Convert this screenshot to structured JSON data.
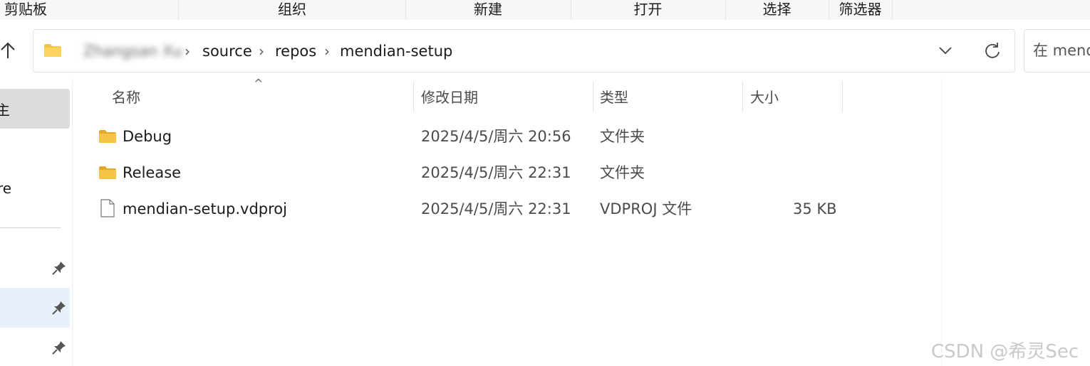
{
  "ribbon": {
    "clipboard": "剪贴板",
    "organize": "组织",
    "new": "新建",
    "open": "打开",
    "select": "选择",
    "filter": "筛选器"
  },
  "address": {
    "blurred_user": "Zhangsan Xu",
    "crumbs": [
      "source",
      "repos",
      "mendian-setup"
    ],
    "separator": "›"
  },
  "search": {
    "placeholder": "在 mendian-setup 中搜索"
  },
  "nav": {
    "selected_fragment": "主",
    "item_fragment": "re"
  },
  "columns": {
    "name": "名称",
    "modified": "修改日期",
    "type": "类型",
    "size": "大小"
  },
  "files": [
    {
      "name": "Debug",
      "modified": "2025/4/5/周六 20:56",
      "type": "文件夹",
      "size": "",
      "icon": "folder-icon"
    },
    {
      "name": "Release",
      "modified": "2025/4/5/周六 22:31",
      "type": "文件夹",
      "size": "",
      "icon": "folder-icon"
    },
    {
      "name": "mendian-setup.vdproj",
      "modified": "2025/4/5/周六 22:31",
      "type": "VDPROJ 文件",
      "size": "35 KB",
      "icon": "file-icon"
    }
  ],
  "watermark": "CSDN @希灵Sec",
  "colors": {
    "folder": "#f6c445",
    "folder_dark": "#e3a92c",
    "selected_bg": "#dddddd",
    "hover_bg": "#e8f1fb"
  }
}
